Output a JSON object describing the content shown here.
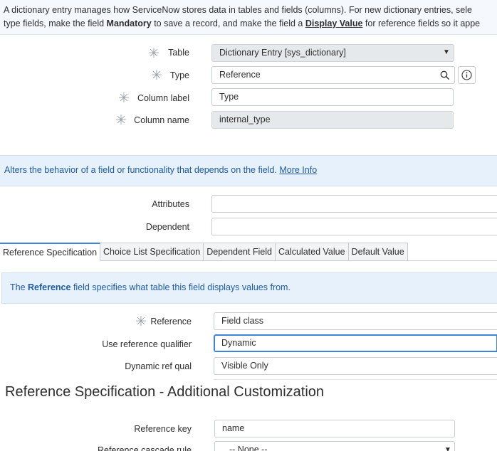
{
  "intro": {
    "line1": "A dictionary entry manages how ServiceNow stores data in tables and fields (columns). For new dictionary entries, sele",
    "line2_a": "type fields, make the field ",
    "line2_mandatory": "Mandatory",
    "line2_b": " to save a record, and make the field a ",
    "line2_display": "Display Value",
    "line2_c": " for reference fields so it appe"
  },
  "fields": {
    "table": {
      "label": "Table",
      "value": "Dictionary Entry [sys_dictionary]"
    },
    "type": {
      "label": "Type",
      "value": "Reference"
    },
    "column_label": {
      "label": "Column label",
      "value": "Type"
    },
    "column_name": {
      "label": "Column name",
      "value": "internal_type"
    },
    "attributes": {
      "label": "Attributes",
      "value": ""
    },
    "dependent": {
      "label": "Dependent",
      "value": ""
    }
  },
  "notice_behavior": {
    "text": "Alters the behavior of a field or functionality that depends on the field. ",
    "link": "More Info"
  },
  "tabs": [
    {
      "label": "Reference Specification",
      "active": true
    },
    {
      "label": "Choice List Specification",
      "active": false
    },
    {
      "label": "Dependent Field",
      "active": false
    },
    {
      "label": "Calculated Value",
      "active": false
    },
    {
      "label": "Default Value",
      "active": false
    }
  ],
  "notice_reference": {
    "a": "The ",
    "bold": "Reference",
    "b": " field specifies what table this field displays values from."
  },
  "ref_fields": {
    "reference": {
      "label": "Reference",
      "value": "Field class"
    },
    "use_qualifier": {
      "label": "Use reference qualifier",
      "value": "Dynamic"
    },
    "dynamic_qual": {
      "label": "Dynamic ref qual",
      "value": "Visible Only"
    }
  },
  "additional": {
    "title": "Reference Specification - Additional Customization",
    "ref_key": {
      "label": "Reference key",
      "value": "name"
    },
    "cascade": {
      "label": "Reference cascade rule",
      "value": "-- None --"
    }
  },
  "icons": {
    "mandatory": "asterisk-icon",
    "search": "search-icon",
    "info": "info-icon",
    "dropdown": "chevron-down-icon"
  },
  "colors": {
    "accent": "#3b84d6",
    "notice_bg": "#e6f1fb",
    "notice_text": "#1d5aa5"
  }
}
